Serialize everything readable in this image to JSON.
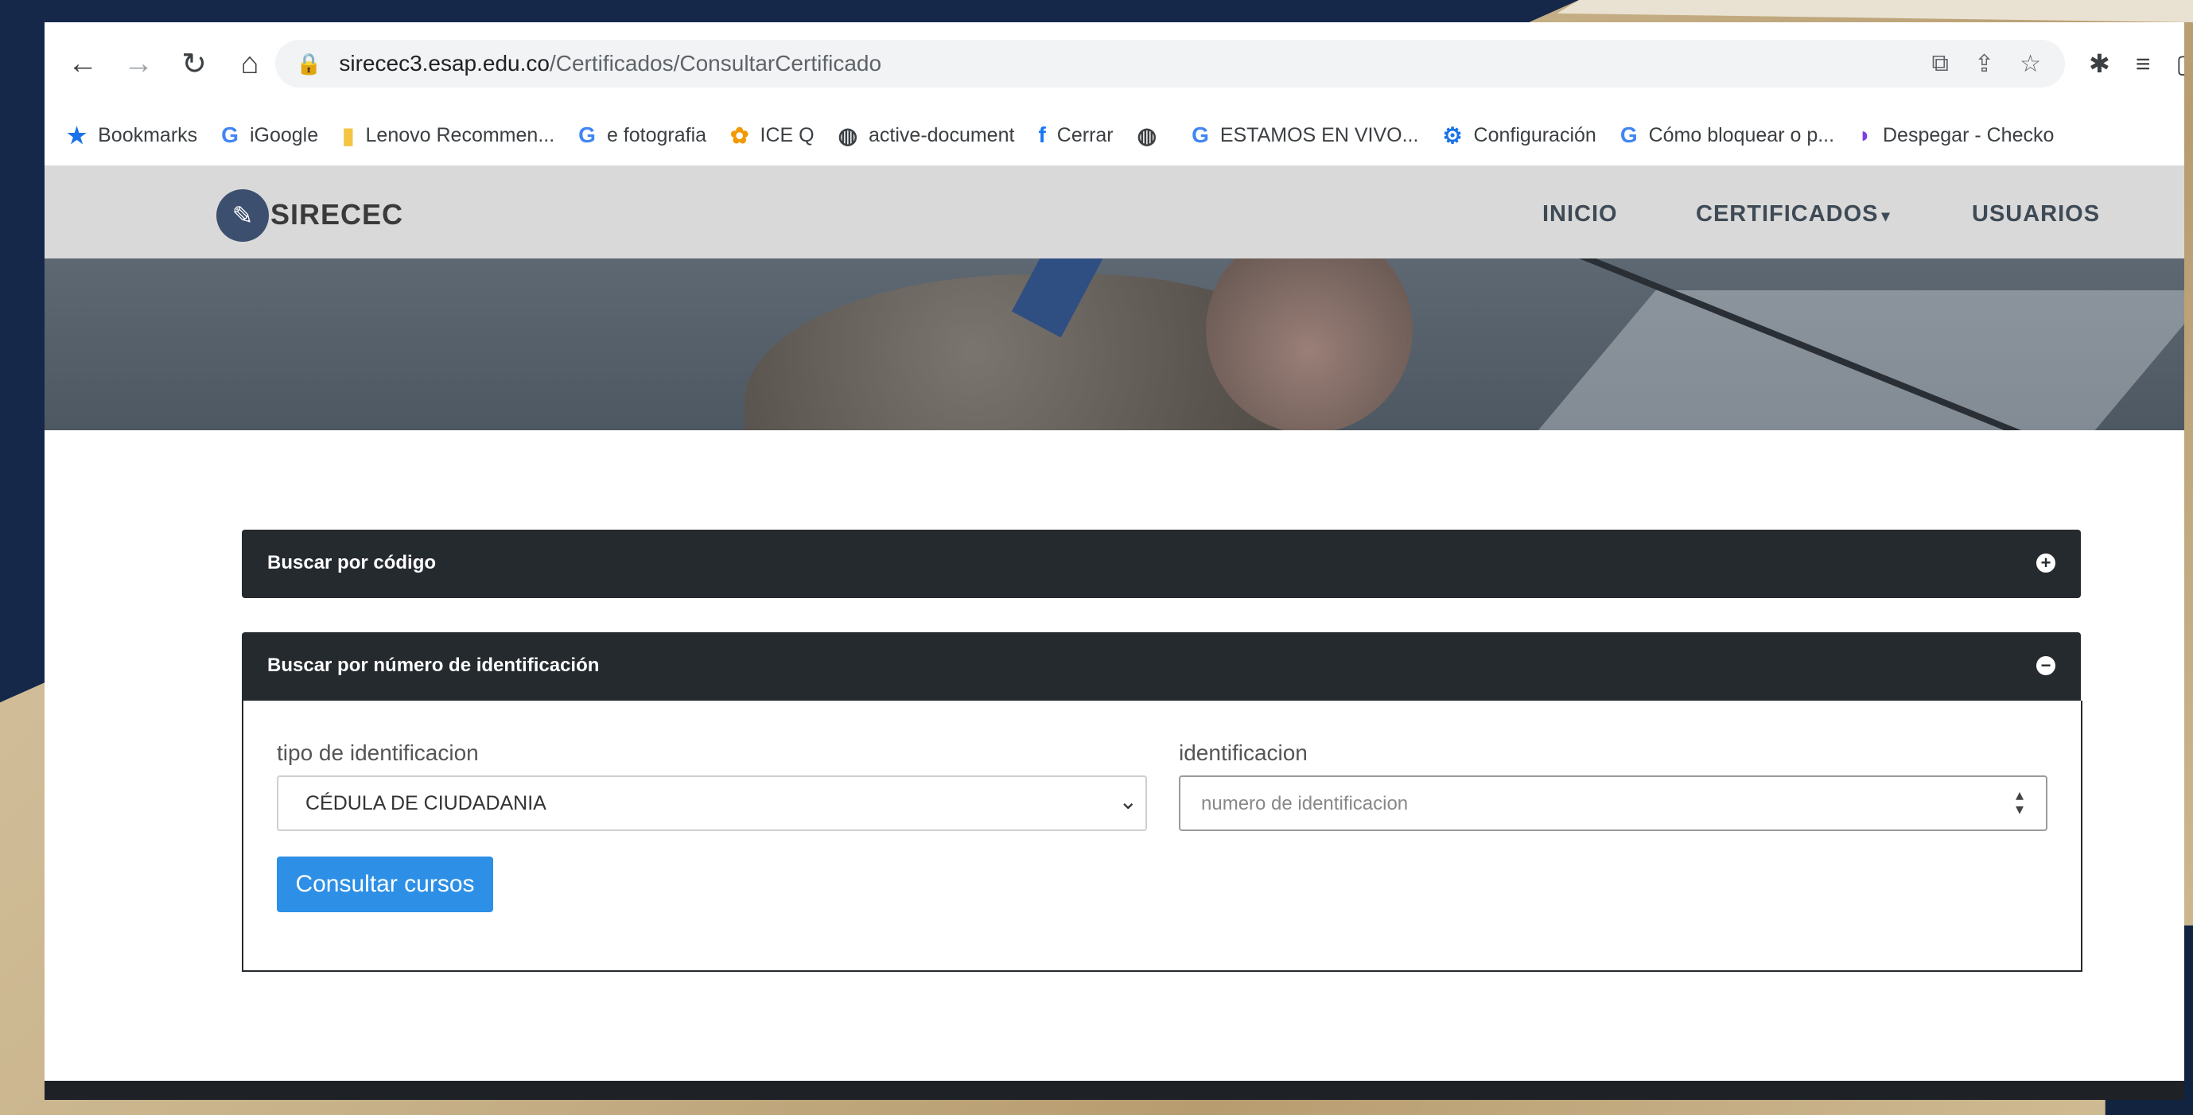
{
  "browser": {
    "url_host": "sirecec3.esap.edu.co",
    "url_path": "/Certificados/ConsultarCertificado",
    "bookmarks": [
      {
        "label": "Bookmarks",
        "icon": "star-icon"
      },
      {
        "label": "iGoogle",
        "icon": "google-icon"
      },
      {
        "label": "Lenovo Recommen...",
        "icon": "folder-icon"
      },
      {
        "label": "e fotografia",
        "icon": "google-icon"
      },
      {
        "label": "ICE Q",
        "icon": "flower-icon"
      },
      {
        "label": "active-document",
        "icon": "globe-icon"
      },
      {
        "label": "Cerrar",
        "icon": "facebook-icon"
      },
      {
        "label": "",
        "icon": "globe-icon"
      },
      {
        "label": "ESTAMOS EN VIVO...",
        "icon": "google-icon"
      },
      {
        "label": "Configuración",
        "icon": "gear-icon"
      },
      {
        "label": "Cómo bloquear o p...",
        "icon": "google-icon"
      },
      {
        "label": "Despegar - Checko",
        "icon": "despegar-icon"
      }
    ]
  },
  "site": {
    "logo": "SIRECEC",
    "nav": {
      "inicio": "INICIO",
      "certificados": "CERTIFICADOS",
      "usuarios": "USUARIOS"
    }
  },
  "panels": {
    "codigo": {
      "title": "Buscar por código"
    },
    "identificacion": {
      "title": "Buscar por número de identificación",
      "tipo_label": "tipo de identificacion",
      "tipo_value": "CÉDULA DE CIUDADANIA",
      "ident_label": "identificacion",
      "ident_placeholder": "numero de identificacion",
      "button": "Consultar cursos"
    }
  },
  "colors": {
    "panel_header": "#252a2f",
    "button": "#2d8fe6",
    "site_header": "#d9d9d9"
  }
}
